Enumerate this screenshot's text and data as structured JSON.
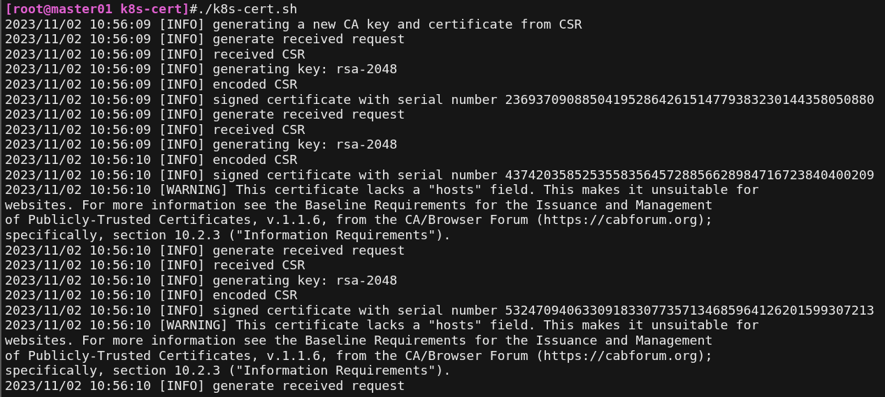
{
  "prompt": "[root@master01 k8s-cert]",
  "command": "#./k8s-cert.sh",
  "output_lines": [
    "2023/11/02 10:56:09 [INFO] generating a new CA key and certificate from CSR",
    "2023/11/02 10:56:09 [INFO] generate received request",
    "2023/11/02 10:56:09 [INFO] received CSR",
    "2023/11/02 10:56:09 [INFO] generating key: rsa-2048",
    "2023/11/02 10:56:09 [INFO] encoded CSR",
    "2023/11/02 10:56:09 [INFO] signed certificate with serial number 236937090885041952864261514779383230144358050880",
    "2023/11/02 10:56:09 [INFO] generate received request",
    "2023/11/02 10:56:09 [INFO] received CSR",
    "2023/11/02 10:56:09 [INFO] generating key: rsa-2048",
    "2023/11/02 10:56:10 [INFO] encoded CSR",
    "2023/11/02 10:56:10 [INFO] signed certificate with serial number 437420358525355835645728856628984716723840400209",
    "2023/11/02 10:56:10 [WARNING] This certificate lacks a \"hosts\" field. This makes it unsuitable for",
    "websites. For more information see the Baseline Requirements for the Issuance and Management",
    "of Publicly-Trusted Certificates, v.1.1.6, from the CA/Browser Forum (https://cabforum.org);",
    "specifically, section 10.2.3 (\"Information Requirements\").",
    "2023/11/02 10:56:10 [INFO] generate received request",
    "2023/11/02 10:56:10 [INFO] received CSR",
    "2023/11/02 10:56:10 [INFO] generating key: rsa-2048",
    "2023/11/02 10:56:10 [INFO] encoded CSR",
    "2023/11/02 10:56:10 [INFO] signed certificate with serial number 532470940633091833077357134685964126201599307213",
    "2023/11/02 10:56:10 [WARNING] This certificate lacks a \"hosts\" field. This makes it unsuitable for",
    "websites. For more information see the Baseline Requirements for the Issuance and Management",
    "of Publicly-Trusted Certificates, v.1.1.6, from the CA/Browser Forum (https://cabforum.org);",
    "specifically, section 10.2.3 (\"Information Requirements\").",
    "2023/11/02 10:56:10 [INFO] generate received request"
  ]
}
